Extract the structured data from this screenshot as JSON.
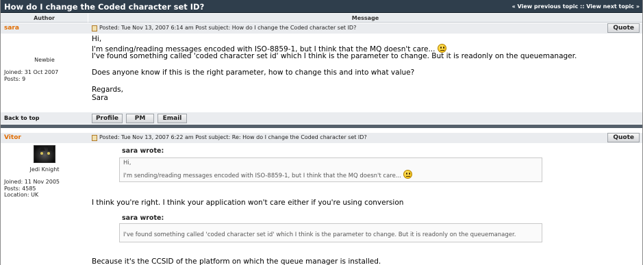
{
  "topic": {
    "title": "How do I change the Coded character set ID?",
    "nav": "« View previous topic :: View next topic »"
  },
  "columns": {
    "author": "Author",
    "message": "Message"
  },
  "posts": [
    {
      "author": "sara",
      "rank": "Newbie",
      "joined": "Joined: 31 Oct 2007",
      "posts": "Posts: 9",
      "posted": "Posted: Tue Nov 13, 2007 6:14 am    Post subject: How do I change the Coded character set ID?",
      "quote_label": "Quote",
      "lines": [
        "Hi,",
        "I'm sending/reading messages encoded with ISO-8859-1, but I think that the MQ doesn't care...",
        "I've found something called 'coded character set id' which I think is the parameter to change. But it is readonly on the queuemanager.",
        "Does anyone know if this is the right parameter, how to change this and into what value?",
        "Regards,",
        "Sara"
      ]
    },
    {
      "author": "Vitor",
      "rank": "Jedi Knight",
      "joined": "Joined: 11 Nov 2005",
      "posts": "Posts: 4585",
      "location": "Location: UK",
      "posted": "Posted: Tue Nov 13, 2007 6:22 am    Post subject: Re: How do I change the Coded character set ID?",
      "quote_label": "Quote",
      "quotes": [
        {
          "label": "sara wrote:",
          "lines": [
            "Hi,",
            "I'm sending/reading messages encoded with ISO-8859-1, but I think that the MQ doesn't care..."
          ]
        },
        {
          "label": "sara wrote:",
          "lines": [
            "I've found something called 'coded character set id' which I think is the parameter to change. But it is readonly on the queuemanager."
          ]
        }
      ],
      "reply_1": "I think you're right. I think your application won't care either if you're using conversion",
      "reply_2": "Because it's the CCSID of the platform on which the queue manager is installed."
    }
  ],
  "footer": {
    "back_to_top": "Back to top",
    "buttons": [
      "Profile",
      "PM",
      "Email"
    ]
  },
  "colors": {
    "topic_bar": "#2f3e4c",
    "author_name": "#e06c00",
    "row_bg": "#eaecef"
  }
}
